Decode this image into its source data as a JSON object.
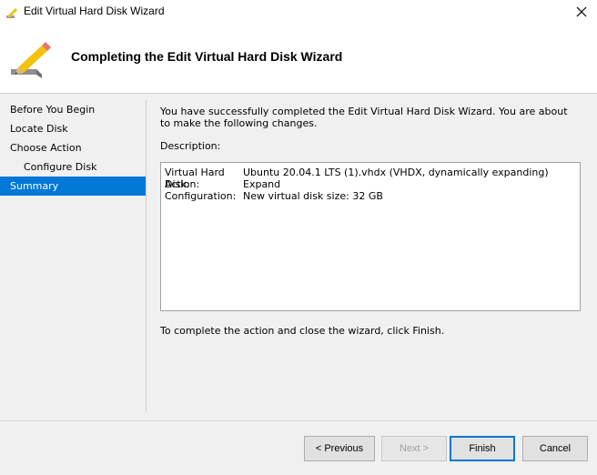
{
  "window": {
    "title": "Edit Virtual Hard Disk Wizard",
    "close_label": "✕"
  },
  "header": {
    "title": "Completing the Edit Virtual Hard Disk Wizard"
  },
  "sidebar": {
    "items": [
      {
        "label": "Before You Begin"
      },
      {
        "label": "Locate Disk"
      },
      {
        "label": "Choose Action"
      },
      {
        "label": "Configure Disk"
      },
      {
        "label": "Summary"
      }
    ]
  },
  "main": {
    "intro": "You have successfully completed the Edit Virtual Hard Disk Wizard. You are about to make the following changes.",
    "description_label": "Description:",
    "details": [
      {
        "key": "Virtual Hard Disk:",
        "value": "Ubuntu 20.04.1 LTS (1).vhdx (VHDX, dynamically expanding)"
      },
      {
        "key": "Action:",
        "value": "Expand"
      },
      {
        "key": "Configuration:",
        "value": "New virtual disk size: 32 GB"
      }
    ],
    "finish_note": "To complete the action and close the wizard, click Finish."
  },
  "buttons": {
    "previous": "< Previous",
    "next": "Next >",
    "finish": "Finish",
    "cancel": "Cancel"
  },
  "colors": {
    "accent": "#0078d7",
    "header_bg": "#ffffff",
    "window_bg": "#f0f0f0"
  },
  "icons": {
    "app": "pencil-disk-icon",
    "header": "pencil-disk-icon",
    "close": "close-icon"
  }
}
